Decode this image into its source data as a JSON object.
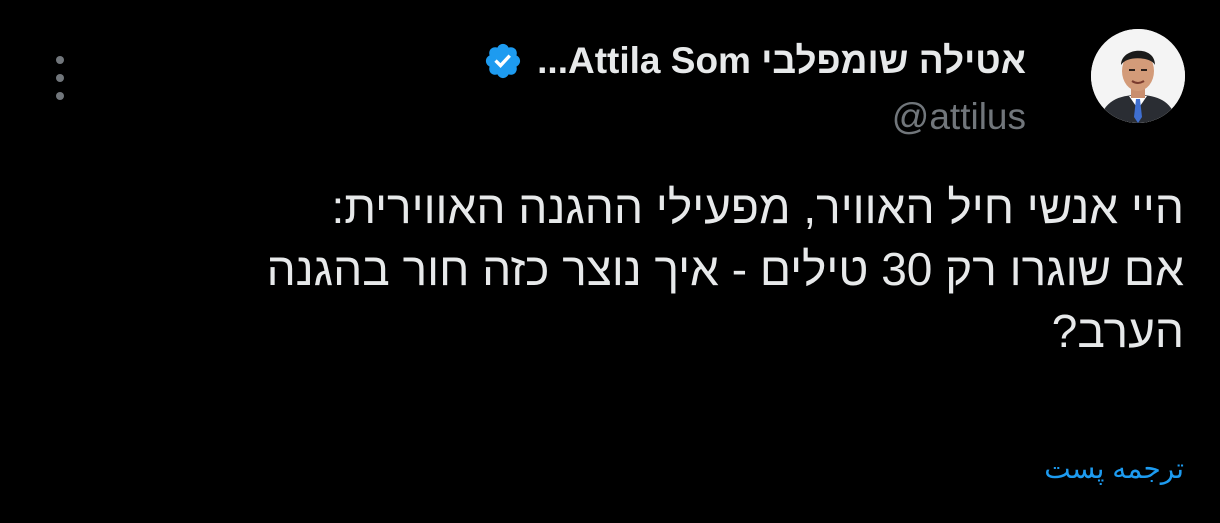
{
  "author": {
    "display_name": "אטילה שומפלבי Attila Som...",
    "handle": "@attilus",
    "verified": true,
    "verified_color": "#1d9bf0"
  },
  "post": {
    "text": "היי אנשי חיל האוויר, מפעילי ההגנה האווירית:\nאם שוגרו רק 30 טילים - איך נוצר כזה חור בהגנה\nהערב?"
  },
  "actions": {
    "translate_label": "ترجمه پست",
    "more_icon": "more-vertical-icon"
  },
  "colors": {
    "background": "#000000",
    "text_primary": "#e7e9ea",
    "text_secondary": "#71767b",
    "accent": "#1d9bf0"
  }
}
